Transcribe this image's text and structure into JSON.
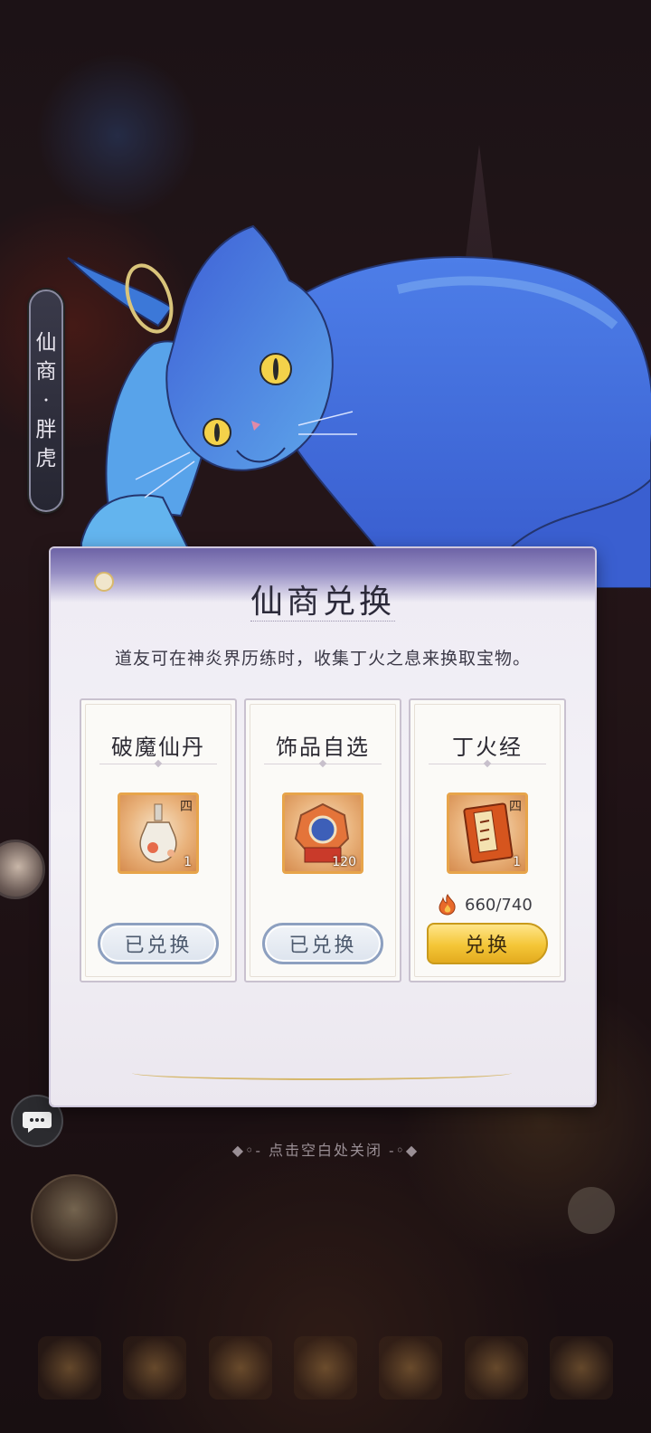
{
  "merchant": {
    "name_chars": [
      "仙",
      "商",
      "·",
      "胖",
      "虎"
    ]
  },
  "dialog": {
    "title": "仙商兑换",
    "description": "道友可在神炎界历练时，收集丁火之息来换取宝物。"
  },
  "items": [
    {
      "name": "破魔仙丹",
      "tier": "四",
      "count": "1",
      "icon": "elixir-bottle-icon",
      "button": "已兑换",
      "status": "redeemed"
    },
    {
      "name": "饰品自选",
      "tier": "",
      "count": "120",
      "icon": "accessory-chest-icon",
      "button": "已兑换",
      "status": "redeemed"
    },
    {
      "name": "丁火经",
      "tier": "四",
      "count": "1",
      "icon": "scripture-book-icon",
      "button": "兑换",
      "status": "available",
      "cost": "660/740",
      "cost_icon": "fire-essence-icon"
    }
  ],
  "close_hint": "点击空白处关闭",
  "colors": {
    "header_purple": "#6d63a6",
    "gold_button": "#f4c637",
    "redeemed_border": "#8da0c0",
    "item_frame": "#e7a44a"
  }
}
